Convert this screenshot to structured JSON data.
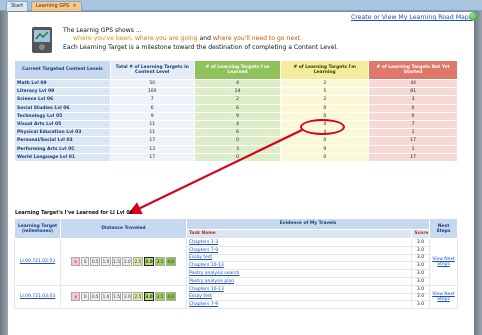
{
  "tabs": [
    {
      "label": "Start",
      "active": false
    },
    {
      "label": "Learning GPS",
      "active": true,
      "close": "×"
    }
  ],
  "header": {
    "roadmap_link": "Create or View My Learning Road Maps",
    "line1": "The Learnig GPS shows ...",
    "line2_parts": [
      "where you've been, ",
      "where you are going",
      " and ",
      "where you'll need to go next."
    ],
    "line3": "Each Learning Target is a milestone toward the destination of completing a Content Level."
  },
  "colors": {
    "learned": "#8fc25a",
    "learning": "#f2ec9c",
    "not_started": "#e0786a",
    "link": "#1a4fbf",
    "annotation": "#d8001a"
  },
  "summary": {
    "headers": [
      "Current Targeted Content Levels",
      "Total # of Learning Targets in Content Level",
      "# of Learning Targets I've Learned",
      "# of Learning Targets I'm Learning",
      "# of Learning Targets Not Yet Started"
    ],
    "rows": [
      {
        "name": "Math Lvl 09",
        "total": "50",
        "learned": "4",
        "learning": "2",
        "not_started": "44"
      },
      {
        "name": "Literacy Lvl 09",
        "total": "100",
        "learned": "14",
        "learning": "5",
        "not_started": "81"
      },
      {
        "name": "Science Lvl 06",
        "total": "7",
        "learned": "2",
        "learning": "2",
        "not_started": "3"
      },
      {
        "name": "Social Studies Lvl 06",
        "total": "6",
        "learned": "6",
        "learning": "0",
        "not_started": "0"
      },
      {
        "name": "Technology Lvl 05",
        "total": "9",
        "learned": "9",
        "learning": "0",
        "not_started": "0"
      },
      {
        "name": "Visual Arts Lvl 05",
        "total": "11",
        "learned": "4",
        "learning": "4",
        "not_started": "7"
      },
      {
        "name": "Physical Education Lvl 03",
        "total": "11",
        "learned": "6",
        "learning": "4",
        "not_started": "1"
      },
      {
        "name": "Personal/Social Lvl 03",
        "total": "17",
        "learned": "0",
        "learning": "0",
        "not_started": "17"
      },
      {
        "name": "Performing Arts Lvl 0C",
        "total": "13",
        "learned": "3",
        "learning": "9",
        "not_started": "1"
      },
      {
        "name": "World Language Lvl 01",
        "total": "17",
        "learned": "0",
        "learning": "0",
        "not_started": "17"
      }
    ]
  },
  "detail": {
    "caption": "Learning Target's I've Learned for LI Lvl 09",
    "headers": {
      "milestone": "Learning Target (milestones)",
      "distance": "Distance Traveled",
      "evidence": "Evidence of My Travels",
      "next": "Next Steps",
      "task_name": "Task Name",
      "score": "Score"
    },
    "scale": [
      "x",
      "0",
      "0.5",
      "1.0",
      "1.5",
      "2.0",
      "2.5",
      "3.0",
      "3.5",
      "4.0"
    ],
    "rows": [
      {
        "milestone": "LI.09.721.02.03",
        "current": "3.0",
        "next": "View Next Steps",
        "tasks": [
          {
            "name": "Chapters 1-3",
            "score": "3.0"
          },
          {
            "name": "Chapters 7-9",
            "score": "3.0"
          },
          {
            "name": "Essay test",
            "score": "3.0"
          },
          {
            "name": "Chapters 10-13",
            "score": "3.0"
          },
          {
            "name": "Poetry analysis search",
            "score": "3.0"
          },
          {
            "name": "Poetry analysis plan",
            "score": "3.0"
          }
        ]
      },
      {
        "milestone": "LI.09.721.03.03",
        "current": "3.0",
        "next": "View Next Steps",
        "tasks": [
          {
            "name": "Chapters 10-13",
            "score": "3.0"
          },
          {
            "name": "Essay test",
            "score": "3.0"
          },
          {
            "name": "Chapters 7-9",
            "score": "3.0"
          }
        ]
      }
    ]
  }
}
